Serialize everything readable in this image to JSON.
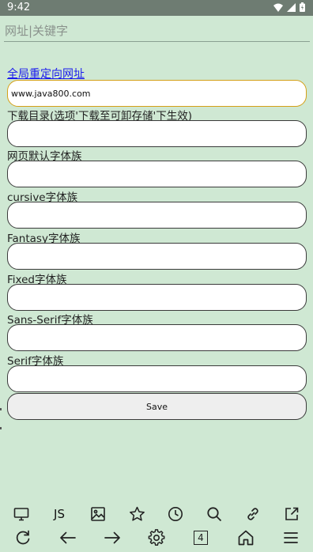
{
  "status_bar": {
    "time": "9:42"
  },
  "url_bar": {
    "placeholder": "网址|关键字",
    "value": ""
  },
  "settings": {
    "redirect_link": "全局重定向网址",
    "redirect_value": "www.java800.com",
    "fields": [
      {
        "label": "下载目录(选项'下载至可卸存储'下生效)",
        "value": ""
      },
      {
        "label": "网页默认字体族",
        "value": ""
      },
      {
        "label": "cursive字体族",
        "value": ""
      },
      {
        "label": "Fantasy字体族",
        "value": ""
      },
      {
        "label": "Fixed字体族",
        "value": ""
      },
      {
        "label": "Sans-Serif字体族",
        "value": ""
      },
      {
        "label": "Serif字体族",
        "value": ""
      }
    ],
    "save_label": "Save"
  },
  "toolbar": {
    "js_label": "JS",
    "tab_count": "4"
  }
}
